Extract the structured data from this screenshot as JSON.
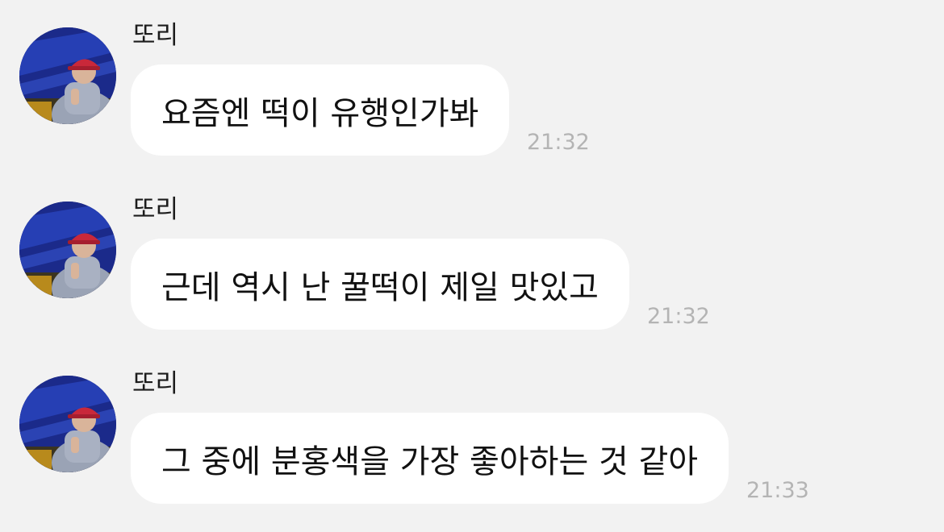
{
  "messages": [
    {
      "sender": "또리",
      "text": "요즘엔 떡이 유행인가봐",
      "time": "21:32"
    },
    {
      "sender": "또리",
      "text": "근데 역시 난 꿀떡이 제일 맛있고",
      "time": "21:32"
    },
    {
      "sender": "또리",
      "text": "그 중에 분홍색을 가장 좋아하는 것 같아",
      "time": "21:33"
    }
  ],
  "colors": {
    "background": "#f2f2f2",
    "bubble": "#ffffff",
    "timestamp": "#b4b4b4",
    "avatar_backdrop": "#1a1f6e",
    "avatar_cap": "#c9283a"
  }
}
